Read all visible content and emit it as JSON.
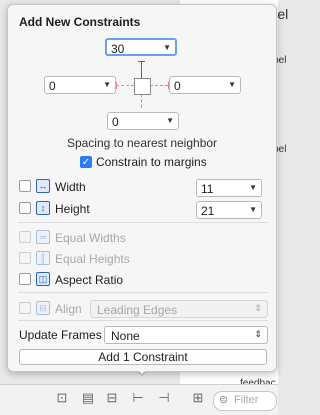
{
  "background": {
    "fragments": [
      "Label",
      "Label",
      "Label",
      "feedbac"
    ],
    "bottom_toolbar_icons": [
      "update-frames-icon",
      "stack-icon",
      "align-icon",
      "pin-icon",
      "resolve-issues-icon"
    ],
    "filter_placeholder": "Filter"
  },
  "popover": {
    "title": "Add New Constraints",
    "spacing": {
      "top": "30",
      "left": "0",
      "right": "0",
      "bottom": "0"
    },
    "spacing_label": "Spacing to nearest neighbor",
    "constrain_to_margins": {
      "label": "Constrain to margins",
      "checked": true
    },
    "width": {
      "label": "Width",
      "value": "11",
      "checked": false
    },
    "height": {
      "label": "Height",
      "value": "21",
      "checked": false
    },
    "equal_widths": {
      "label": "Equal Widths",
      "enabled": false
    },
    "equal_heights": {
      "label": "Equal Heights",
      "enabled": false
    },
    "aspect_ratio": {
      "label": "Aspect Ratio",
      "checked": false
    },
    "align": {
      "label": "Align",
      "value": "Leading Edges",
      "enabled": false
    },
    "update_frames": {
      "label": "Update Frames",
      "value": "None"
    },
    "add_button": "Add 1 Constraint"
  },
  "colors": {
    "accent": "#2c7cf6",
    "strut": "#dd3333",
    "icon": "#2a63b8"
  }
}
